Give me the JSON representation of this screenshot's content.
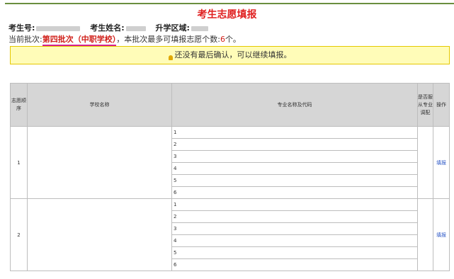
{
  "header": {
    "title": "考生志愿填报",
    "candidate_no_label": "考生号:",
    "candidate_name_label": "考生姓名:",
    "district_label": "升学区域:"
  },
  "batch": {
    "prefix": "当前批次:",
    "name": "第四批次（中职学校）",
    "middle": "，本批次最多可填报志愿个数:",
    "count": "6",
    "suffix": "个。"
  },
  "notice": {
    "text": "还没有最后确认，可以继续填报。",
    "icon": "lightbulb-icon"
  },
  "table": {
    "headers": {
      "seq": "志愿顺序",
      "school": "学校名称",
      "major": "专业名称及代码",
      "adjust": "是否服从专业调配",
      "op": "操作"
    },
    "rows": [
      {
        "seq": "1",
        "majors": [
          "1",
          "2",
          "3",
          "4",
          "5",
          "6"
        ],
        "action": "填报"
      },
      {
        "seq": "2",
        "majors": [
          "1",
          "2",
          "3",
          "4",
          "5",
          "6"
        ],
        "action": "填报"
      }
    ]
  }
}
